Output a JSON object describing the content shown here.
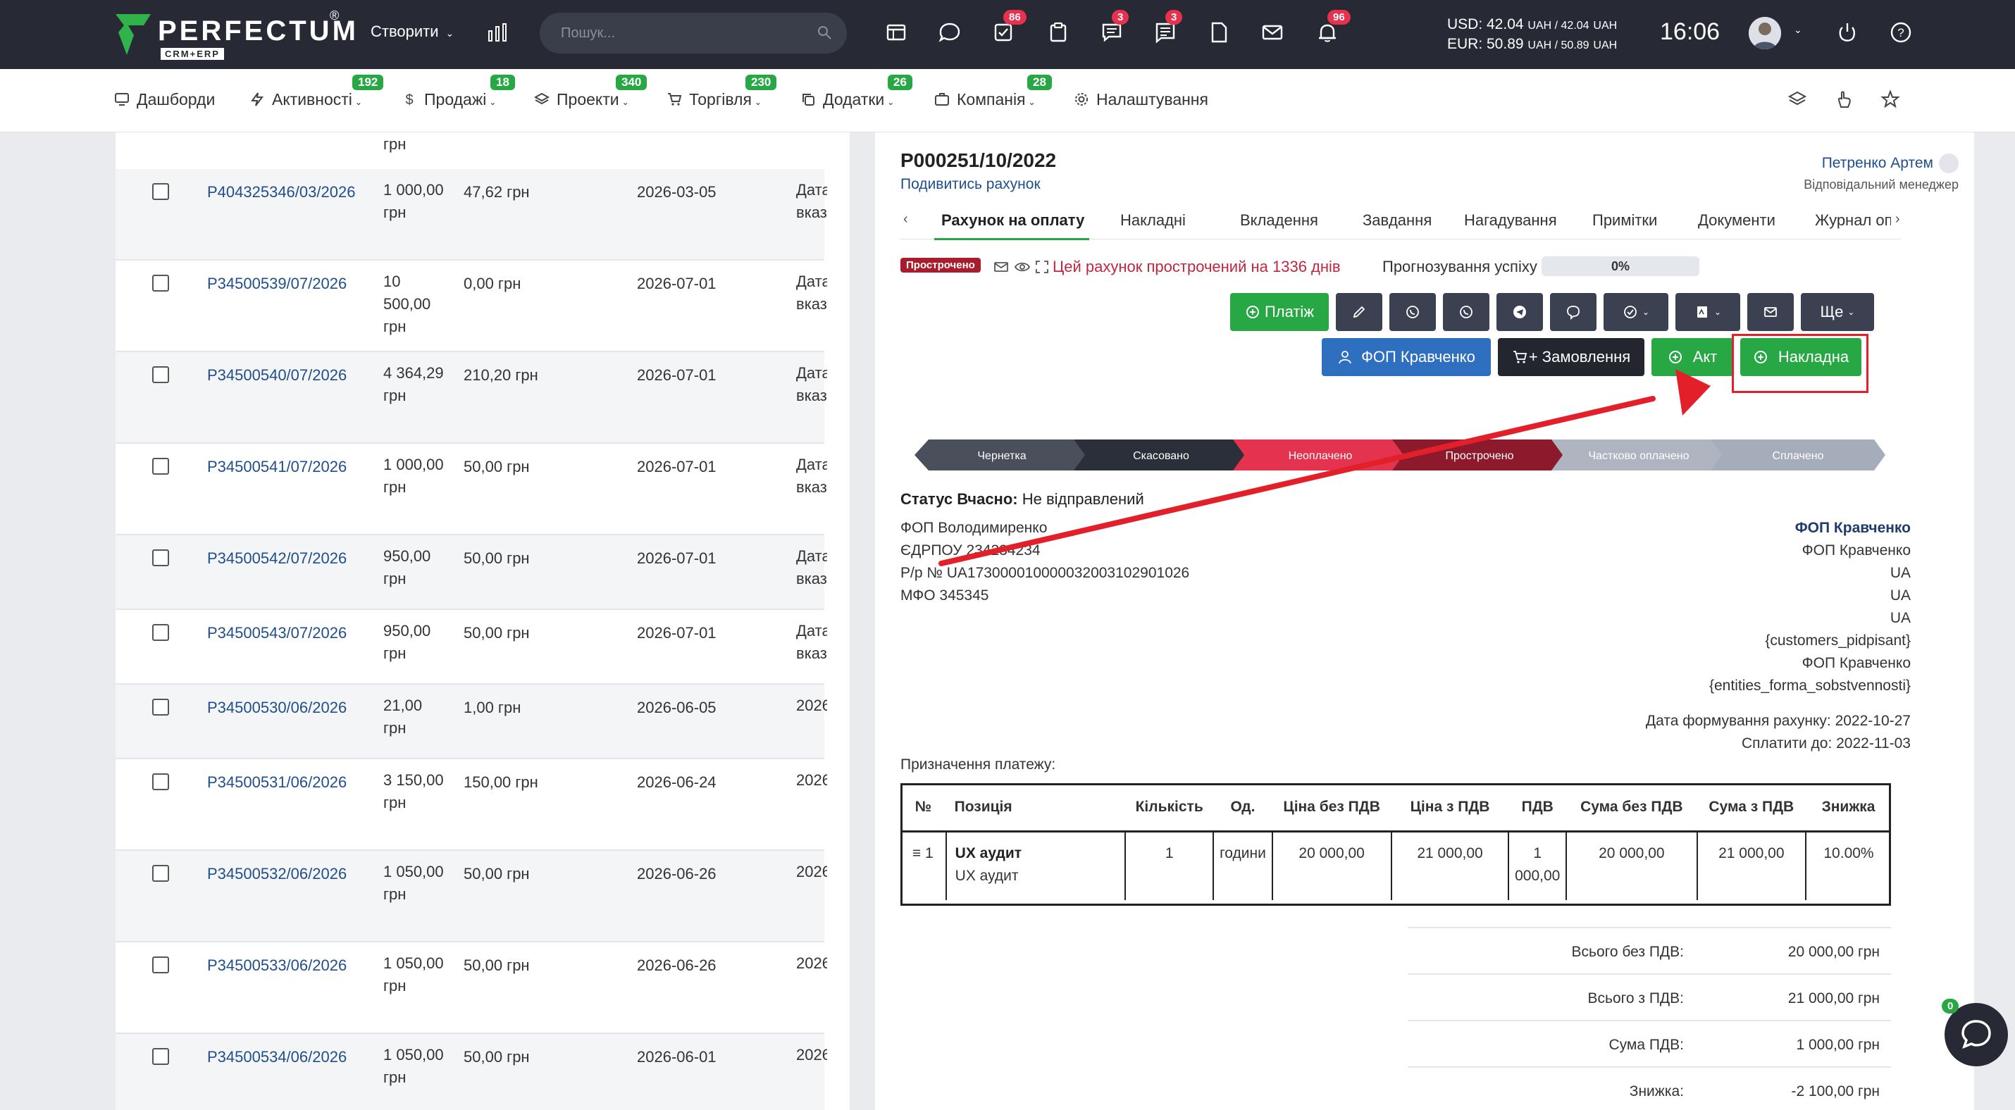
{
  "topbar": {
    "logo_text": "PERFECTUM",
    "logo_reg": "®",
    "logo_sub": "CRM+ERP",
    "create_label": "Створити",
    "search_placeholder": "Пошук...",
    "badges": [
      "86",
      "3",
      "3",
      "96"
    ],
    "rates_usd": "USD: 42.04",
    "rates_usd_tail": "UAH / 42.04",
    "rates_usd_unit": "UAH",
    "rates_eur": "EUR: 50.89",
    "rates_eur_tail": "UAH / 50.89",
    "rates_eur_unit": "UAH",
    "time": "16:06"
  },
  "nav": {
    "items": [
      {
        "label": "Дашборди",
        "badge": ""
      },
      {
        "label": "Активності",
        "badge": "192"
      },
      {
        "label": "Продажі",
        "badge": "18"
      },
      {
        "label": "Проекти",
        "badge": "340"
      },
      {
        "label": "Торгівля",
        "badge": "230"
      },
      {
        "label": "Додатки",
        "badge": "26"
      },
      {
        "label": "Компанія",
        "badge": "28"
      },
      {
        "label": "Налаштування",
        "badge": ""
      }
    ]
  },
  "left_list": {
    "top_cut": "грн",
    "rows": [
      {
        "number": "P404325346/03/2026",
        "amount": "1 000,00 грн",
        "paid": "47,62 грн",
        "date": "2026-03-05",
        "note": "Дата вказ"
      },
      {
        "number": "P34500539/07/2026",
        "amount": "10 500,00 грн",
        "paid": "0,00 грн",
        "date": "2026-07-01",
        "note": "Дата вказ"
      },
      {
        "number": "P34500540/07/2026",
        "amount": "4 364,29 грн",
        "paid": "210,20 грн",
        "date": "2026-07-01",
        "note": "Дата вказ"
      },
      {
        "number": "P34500541/07/2026",
        "amount": "1 000,00 грн",
        "paid": "50,00 грн",
        "date": "2026-07-01",
        "note": "Дата вказ"
      },
      {
        "number": "P34500542/07/2026",
        "amount": "950,00 грн",
        "paid": "50,00 грн",
        "date": "2026-07-01",
        "note": "Дата вказ"
      },
      {
        "number": "P34500543/07/2026",
        "amount": "950,00 грн",
        "paid": "50,00 грн",
        "date": "2026-07-01",
        "note": "Дата вказ"
      },
      {
        "number": "P34500530/06/2026",
        "amount": "21,00 грн",
        "paid": "1,00 грн",
        "date": "2026-06-05",
        "note": "2026"
      },
      {
        "number": "P34500531/06/2026",
        "amount": "3 150,00 грн",
        "paid": "150,00 грн",
        "date": "2026-06-24",
        "note": "2026"
      },
      {
        "number": "P34500532/06/2026",
        "amount": "1 050,00 грн",
        "paid": "50,00 грн",
        "date": "2026-06-26",
        "note": "2026"
      },
      {
        "number": "P34500533/06/2026",
        "amount": "1 050,00 грн",
        "paid": "50,00 грн",
        "date": "2026-06-26",
        "note": "2026"
      },
      {
        "number": "P34500534/06/2026",
        "amount": "1 050,00 грн",
        "paid": "50,00 грн",
        "date": "2026-06-01",
        "note": "2026"
      }
    ]
  },
  "invoice": {
    "number": "P000251/10/2022",
    "view_link": "Подивитись рахунок",
    "manager_name": "Петренко Артем",
    "manager_role": "Відповідальний менеджер",
    "tabs": [
      "Рахунок на оплату",
      "Накладні",
      "Вкладення",
      "Завдання",
      "Нагадування",
      "Примітки",
      "Документи",
      "Журнал опе"
    ],
    "overdue_badge": "Прострочено",
    "overdue_text": "Цей рахунок прострочений на 1336 днів",
    "forecast_label": "Прогнозування успіху",
    "forecast_percent": "0%",
    "forecast_value": 0,
    "buttons": {
      "payment": "Платіж",
      "more": "Ще",
      "fop": "ФОП Кравченко",
      "order": "+ Замовлення",
      "act": "Акт",
      "waybill": "Накладна"
    },
    "stages": [
      "Чернетка",
      "Скасовано",
      "Неоплачено",
      "Прострочено",
      "Частково оплачено",
      "Сплачено"
    ],
    "status_label": "Статус Вчасно:",
    "status_value": "Не відправлений",
    "buyer": {
      "name": "ФОП Володимиренко",
      "edrpou": "ЄДРПОУ 234234234",
      "account": "Р/р № UA173000010000032003102901026",
      "mfo": "МФО 345345"
    },
    "seller": {
      "name": "ФОП Кравченко",
      "line1": "ФОП Кравченко",
      "line2": "UA",
      "line3": "UA",
      "line4": "UA",
      "line5": "{customers_pidpisant}",
      "line6": "ФОП Кравченко",
      "line7": "{entities_forma_sobstvennosti}"
    },
    "date_formed": "Дата формування рахунку: 2022-10-27",
    "pay_until": "Сплатити до: 2022-11-03",
    "purpose_label": "Призначення платежу:",
    "table": {
      "headers": [
        "№",
        "Позиція",
        "Кількість",
        "Од.",
        "Ціна без ПДВ",
        "Ціна з ПДВ",
        "ПДВ",
        "Сума без ПДВ",
        "Сума з ПДВ",
        "Знижка"
      ],
      "row": {
        "no": "1",
        "name": "UX аудит",
        "desc": "UX аудит",
        "qty": "1",
        "unit": "години",
        "price_no_vat": "20 000,00",
        "price_vat": "21 000,00",
        "vat": "1 000,00",
        "sum_no_vat": "20 000,00",
        "sum_vat": "21 000,00",
        "discount": "10.00%"
      }
    },
    "totals": [
      {
        "label": "Всього без ПДВ:",
        "value": "20 000,00 грн"
      },
      {
        "label": "Всього з ПДВ:",
        "value": "21 000,00 грн"
      },
      {
        "label": "Сума ПДВ:",
        "value": "1 000,00 грн"
      },
      {
        "label": "Знижка:",
        "value": "-2 100,00 грн"
      }
    ]
  },
  "chat": {
    "badge": "0"
  },
  "colors": {
    "accent_green": "#28a745",
    "overdue_red": "#c0273d",
    "annotation_red": "#e3202a",
    "topbar": "#272a35"
  }
}
